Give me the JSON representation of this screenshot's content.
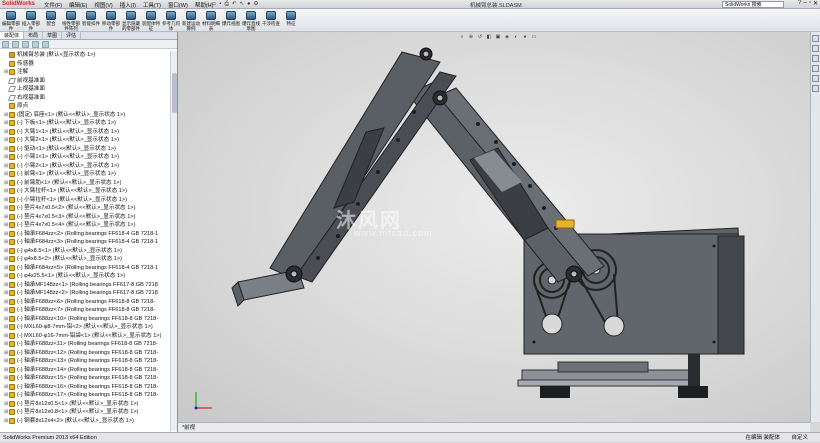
{
  "app": {
    "logo_text": "SolidWorks",
    "title": "机械臂总装.SLDASM",
    "search_placeholder": "SolidWorks 搜索"
  },
  "menus": [
    "文件(F)",
    "编辑(E)",
    "视图(V)",
    "插入(I)",
    "工具(T)",
    "窗口(W)",
    "帮助(H)"
  ],
  "toolbar": {
    "buttons": [
      "编辑零部件",
      "插入零部件",
      "配合",
      "线性零部件阵列",
      "智能扣件",
      "移动零部件",
      "显示隐藏的零部件",
      "装配体特征",
      "参考几何体",
      "新建运动算例",
      "材料明细表",
      "爆炸视图",
      "爆炸直线草图",
      "干涉检查",
      "特征"
    ]
  },
  "panel": {
    "tabs": [
      "装配体",
      "布局",
      "草图",
      "评估"
    ],
    "tree": [
      {
        "label": "机械臂总装 (默认<显示状态-1>)",
        "kind": "asm",
        "toggle": ""
      },
      {
        "label": "传感器",
        "kind": "folder",
        "toggle": ""
      },
      {
        "label": "注解",
        "kind": "folder",
        "toggle": "⊞"
      },
      {
        "label": "前视基准面",
        "kind": "plane",
        "toggle": ""
      },
      {
        "label": "上视基准面",
        "kind": "plane",
        "toggle": ""
      },
      {
        "label": "右视基准面",
        "kind": "plane",
        "toggle": ""
      },
      {
        "label": "原点",
        "kind": "origin",
        "toggle": ""
      },
      {
        "label": "(固定) 底座<1> (默认<<默认>_显示状态 1>)",
        "kind": "part",
        "toggle": "⊞"
      },
      {
        "label": "(-) 下板<1> (默认<<默认>_显示状态 1>)",
        "kind": "part",
        "toggle": "⊞"
      },
      {
        "label": "(-) 大臂1<1> (默认<<默认>_显示状态 1>)",
        "kind": "part",
        "toggle": "⊞"
      },
      {
        "label": "(-) 大臂2<1> (默认<<默认>_显示状态 1>)",
        "kind": "part",
        "toggle": "⊞"
      },
      {
        "label": "(-) 驱动<1> (默认<<默认>_显示状态 1>)",
        "kind": "part",
        "toggle": "⊞"
      },
      {
        "label": "(-) 小臂1<1> (默认<<默认>_显示状态 1>)",
        "kind": "part",
        "toggle": "⊞"
      },
      {
        "label": "(-) 小臂2<1> (默认<<默认>_显示状态 1>)",
        "kind": "part",
        "toggle": "⊞"
      },
      {
        "label": "(-) 前臂<1> (默认<<默认>_显示状态 1>)",
        "kind": "part",
        "toggle": "⊞"
      },
      {
        "label": "(-) 前臂肋<1> (默认<<默认>_显示状态 1>)",
        "kind": "part",
        "toggle": "⊞"
      },
      {
        "label": "(-) 大臂拉杆<1> (默认<<默认>_显示状态 1>)",
        "kind": "part",
        "toggle": "⊞"
      },
      {
        "label": "(-) 小臂拉杆<1> (默认<<默认>_显示状态 1>)",
        "kind": "part",
        "toggle": "⊞"
      },
      {
        "label": "(-) 垫片4x7x0.5<2> (默认<<默认>_显示状态 1>)",
        "kind": "part",
        "toggle": "⊞"
      },
      {
        "label": "(-) 垫片4x7x0.5<3> (默认<<默认>_显示状态 1>)",
        "kind": "part",
        "toggle": "⊞"
      },
      {
        "label": "(-) 垫片4x7x0.5<4> (默认<<默认>_显示状态 1>)",
        "kind": "part",
        "toggle": "⊞"
      },
      {
        "label": "(-) 轴承F684zz<2> (Rolling bearings FF618-4  GB 7218-1",
        "kind": "part",
        "toggle": "⊞"
      },
      {
        "label": "(-) 轴承F684zz<3> (Rolling bearings FF618-4  GB 7218-1",
        "kind": "part",
        "toggle": "⊞"
      },
      {
        "label": "(-) φ4x8.5<1> (默认<<默认>_显示状态 1>)",
        "kind": "part",
        "toggle": "⊞"
      },
      {
        "label": "(-) φ4x8.5<2> (默认<<默认>_显示状态 1>)",
        "kind": "part",
        "toggle": "⊞"
      },
      {
        "label": "(-) 轴承F684zz<5> (Rolling bearings FF618-4  GB 7218-1",
        "kind": "part",
        "toggle": "⊞"
      },
      {
        "label": "(-) φ4x25.5<1> (默认<<默认>_显示状态 1>)",
        "kind": "part",
        "toggle": "⊞"
      },
      {
        "label": "(-) 轴承MF148zz<1> (Rolling bearings FF617-8  GB 7218",
        "kind": "part",
        "toggle": "⊞"
      },
      {
        "label": "(-) 轴承MF148zz<2> (Rolling bearings FF617-8  GB 7218",
        "kind": "part",
        "toggle": "⊞"
      },
      {
        "label": "(-) 轴承F688zz<6> (Rolling bearings FF618-8  GB 7218-",
        "kind": "part",
        "toggle": "⊞"
      },
      {
        "label": "(-) 轴承F688zz<7> (Rolling bearings FF618-8  GB 7218-",
        "kind": "part",
        "toggle": "⊞"
      },
      {
        "label": "(-) 轴承F688zz<10> (Rolling bearings FF618-8  GB 7218-",
        "kind": "part",
        "toggle": "⊞"
      },
      {
        "label": "(-) MXL60-φ8-7mm-铝<2> (默认<<默认>_显示状态 1>)",
        "kind": "part",
        "toggle": "⊞"
      },
      {
        "label": "(-) MXL60-φ16-7mm-铝袋<1> (默认<<默认>_显示状态 1>)",
        "kind": "part",
        "toggle": "⊞"
      },
      {
        "label": "(-) 轴承F688zz<11> (Rolling bearings FF618-8  GB 7218-",
        "kind": "part",
        "toggle": "⊞"
      },
      {
        "label": "(-) 轴承F688zz<12> (Rolling bearings FF618-8  GB 7218-",
        "kind": "part",
        "toggle": "⊞"
      },
      {
        "label": "(-) 轴承F688zz<13> (Rolling bearings FF618-8  GB 7218-",
        "kind": "part",
        "toggle": "⊞"
      },
      {
        "label": "(-) 轴承F688zz<14> (Rolling bearings FF618-8  GB 7218-",
        "kind": "part",
        "toggle": "⊞"
      },
      {
        "label": "(-) 轴承F688zz<15> (Rolling bearings FF618-8  GB 7218-",
        "kind": "part",
        "toggle": "⊞"
      },
      {
        "label": "(-) 轴承F688zz<16> (Rolling bearings FF618-8  GB 7218-",
        "kind": "part",
        "toggle": "⊞"
      },
      {
        "label": "(-) 轴承F688zz<17> (Rolling bearings FF618-8  GB 7218-",
        "kind": "part",
        "toggle": "⊞"
      },
      {
        "label": "(-) 垫片8x12x0.5<1> (默认<<默认>_显示状态 1>)",
        "kind": "part",
        "toggle": "⊞"
      },
      {
        "label": "(-) 垫片8x12x0.8<1> (默认<<默认>_显示状态 1>)",
        "kind": "part",
        "toggle": "⊞"
      },
      {
        "label": "(-) 钢套8x12x4<2> (默认<<默认>_显示状态 1>)",
        "kind": "part",
        "toggle": "⊞"
      }
    ]
  },
  "viewport": {
    "watermark": "沐风网",
    "watermark_url": "www.mfcad.com"
  },
  "file_tab": "*前视",
  "status": {
    "left": "SolidWorks Premium 2013 x64 Edition",
    "right1": "在编辑 装配体",
    "right2": "自定义"
  },
  "colors": {
    "model": "#5a5f66",
    "accent": "#e8b22a"
  }
}
